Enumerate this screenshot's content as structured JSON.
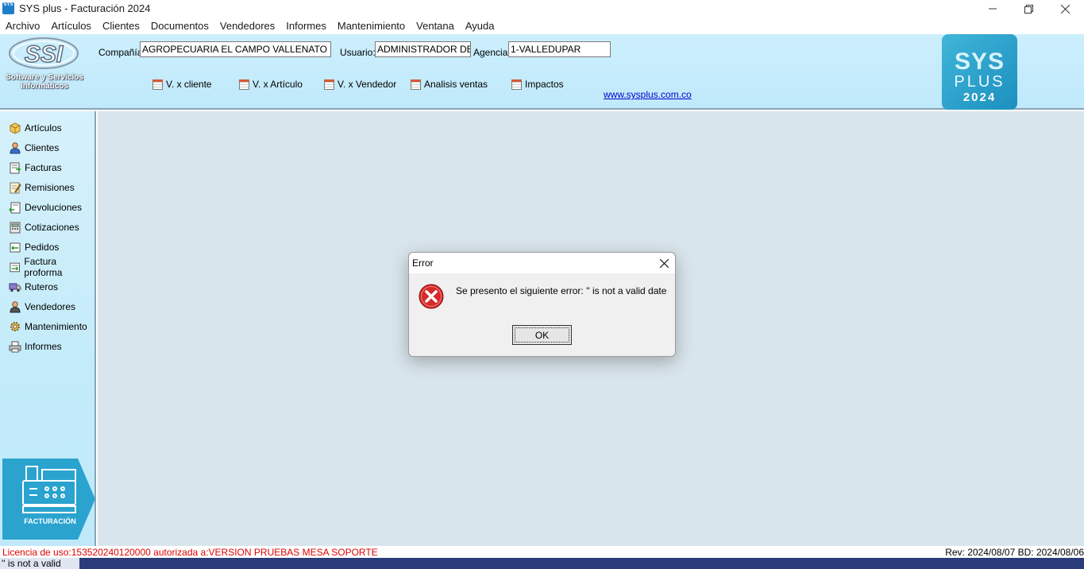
{
  "window": {
    "title": "SYS plus - Facturación 2024",
    "icon_text": "SYS"
  },
  "menu": [
    "Archivo",
    "Artículos",
    "Clientes",
    "Documentos",
    "Vendedores",
    "Informes",
    "Mantenimiento",
    "Ventana",
    "Ayuda"
  ],
  "header": {
    "ssi_logo_text": "SSI",
    "ssi_subtitle": "Software y Servicios Informáticos",
    "company_label": "Compañía:",
    "company_value": "AGROPECUARIA EL CAMPO VALLENATO S.A.S",
    "user_label": "Usuario:",
    "user_value": "ADMINISTRADOR DEL",
    "agency_label": "Agencia",
    "agency_value": "1-VALLEDUPAR",
    "quick_links": [
      "V. x cliente",
      "V. x Artículo",
      "V. x Vendedor",
      "Analisis ventas",
      "Impactos"
    ],
    "website": "www.sysplus.com.co",
    "sys_logo": {
      "line1": "SYS",
      "line2": "PLUS",
      "line3": "2024"
    }
  },
  "sidebar": {
    "items": [
      {
        "label": "Artículos",
        "icon": "box-icon"
      },
      {
        "label": "Clientes",
        "icon": "person-icon"
      },
      {
        "label": "Facturas",
        "icon": "invoice-icon"
      },
      {
        "label": "Remisiones",
        "icon": "note-edit-icon"
      },
      {
        "label": "Devoluciones",
        "icon": "return-icon"
      },
      {
        "label": "Cotizaciones",
        "icon": "calculator-icon"
      },
      {
        "label": "Pedidos",
        "icon": "order-icon"
      },
      {
        "label": "Factura proforma",
        "icon": "proforma-icon"
      },
      {
        "label": "Ruteros",
        "icon": "truck-icon"
      },
      {
        "label": "Vendedores",
        "icon": "salesman-icon"
      },
      {
        "label": "Mantenimiento",
        "icon": "gear-icon"
      },
      {
        "label": "Informes",
        "icon": "printer-icon"
      }
    ],
    "banner_label": "FACTURACIÓN"
  },
  "dialog": {
    "title": "Error",
    "message": "Se presento el siguiente error: '' is not a valid date",
    "ok_label": "OK"
  },
  "status": {
    "license": "Licencia de uso:153520240120000 autorizada a:VERSION PRUEBAS MESA SOPORTE",
    "revision": "Rev: 2024/08/07 BD: 2024/08/06",
    "message": "'' is not a valid date"
  },
  "colors": {
    "header_bg": "#c5ecfb",
    "main_bg": "#d9e5ec",
    "license_text": "#e00000",
    "statusbar_bg": "#2a3d7a",
    "sys_logo": "#2aa3cf"
  }
}
